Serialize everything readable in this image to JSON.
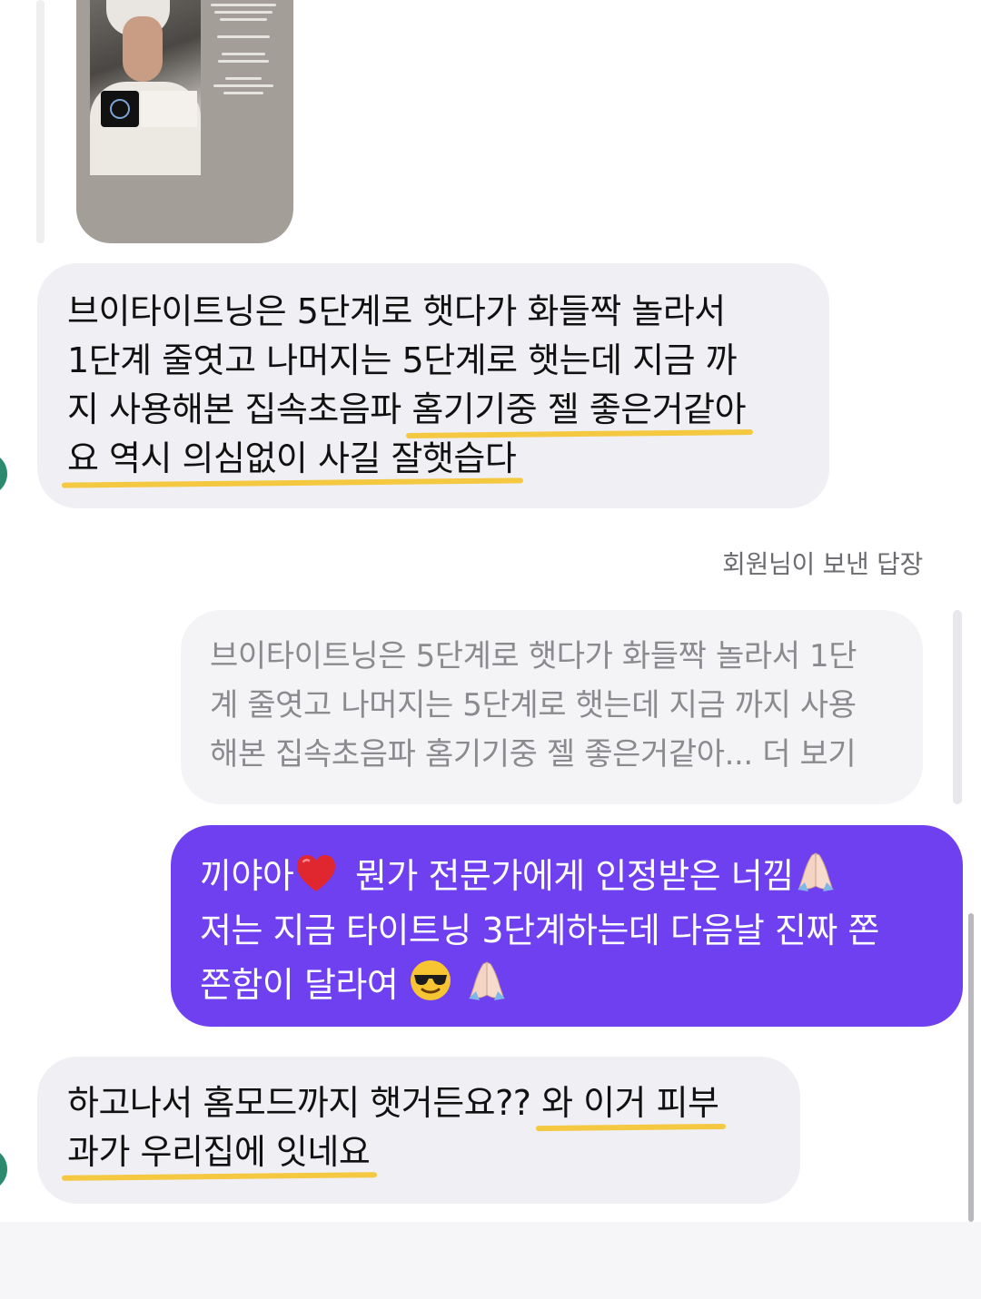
{
  "shared_story": {
    "icon": "story-thumbnail"
  },
  "messages": [
    {
      "id": "msg1",
      "direction": "received",
      "lines": [
        "브이타이트닝은 5단계로 햇다가 화들짝 놀라서",
        "1단계 줄엿고 나머지는 5단계로 햇는데 지금 까",
        "지 사용해본 집속초음파 ",
        "홈기기중 젤 좋은거같아",
        "요 역시 의심없이 사길 잘햇습다"
      ]
    },
    {
      "id": "reply",
      "label": "회원님이 보낸 답장",
      "quoted_lines": [
        "브이타이트닝은 5단계로 햇다가 화들짝 놀라서 1단",
        "계 줄엿고 나머지는 5단계로 햇는데 지금 까지 사용",
        "해본 집속초음파 홈기기중 젤 좋은거같아... 더 보기"
      ]
    },
    {
      "id": "msg3",
      "direction": "sent",
      "line1_a": "끼야아",
      "line1_b": " 뭔가 전문가에게 인정받은 너낌",
      "line2": "저는 지금 타이트닝 3단계하는데 다음날 진짜 쫀",
      "line3": "쫀함이 달라여 ",
      "emojis": [
        "red-heart",
        "folded-hands",
        "smiling-face-with-sunglasses",
        "folded-hands"
      ]
    },
    {
      "id": "msg4",
      "direction": "received",
      "line1_a": "하고나서 홈모드까지 햇거든요?? ",
      "line1_b": "와 이거 피부",
      "line2": "과가 우리집에 잇네요"
    }
  ],
  "colors": {
    "sent_bubble": "#6e40f0",
    "received_bubble": "#efeff4",
    "highlight": "#f5c842",
    "avatar": "#2c8a6e"
  }
}
